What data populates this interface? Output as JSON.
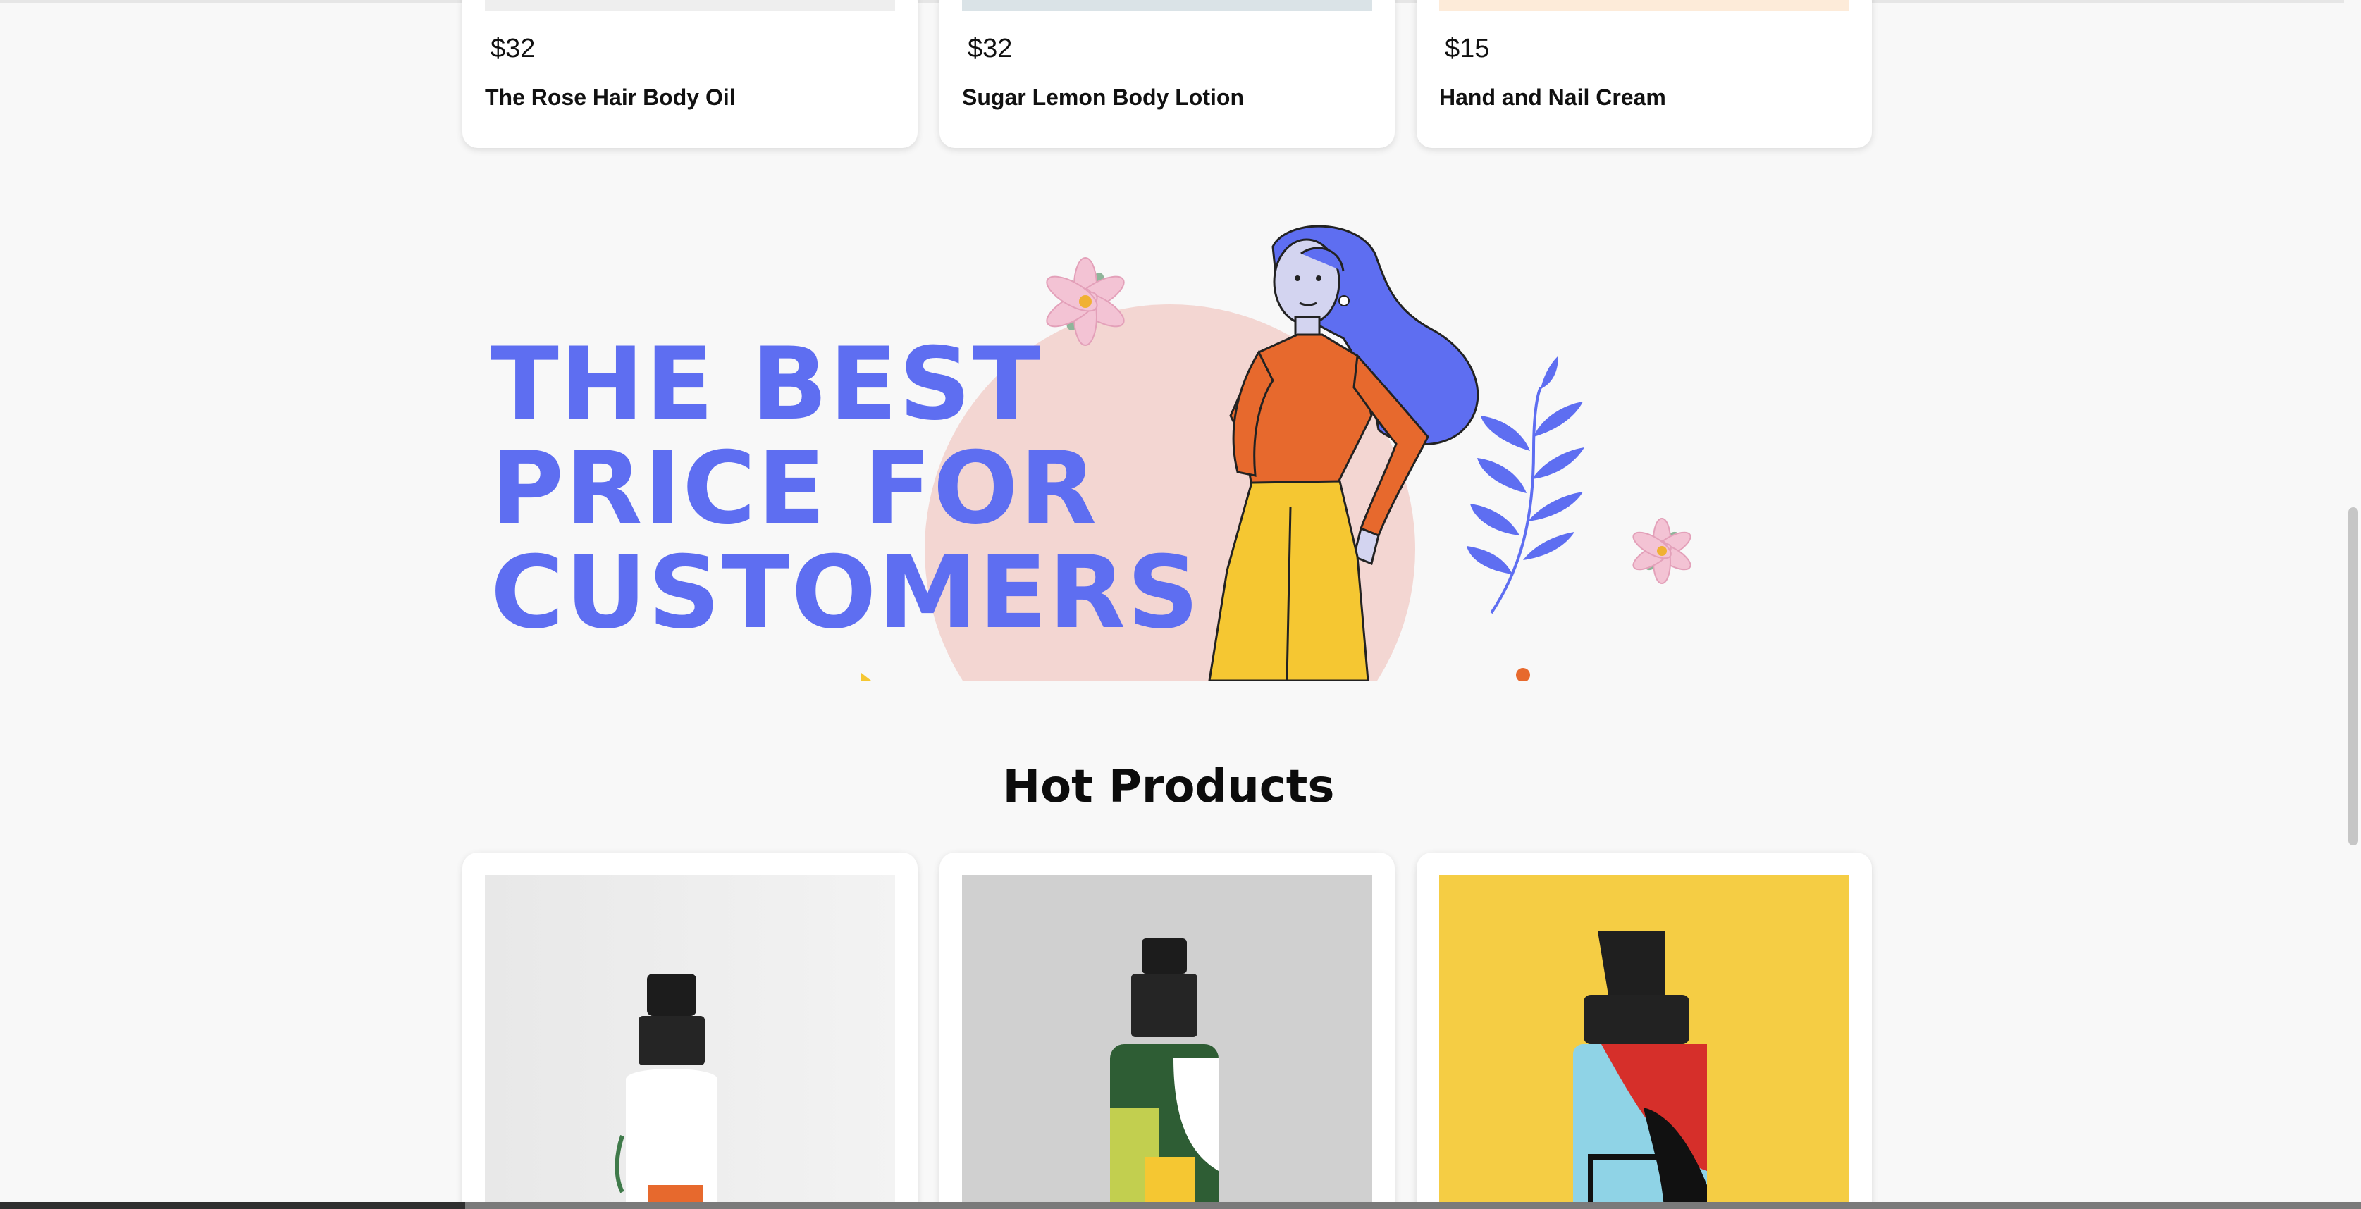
{
  "top_products": [
    {
      "price": "$32",
      "name": "The Rose Hair Body Oil",
      "strip_color": "#eeeeee"
    },
    {
      "price": "$32",
      "name": "Sugar Lemon Body Lotion",
      "strip_color": "#dae3e7"
    },
    {
      "price": "$15",
      "name": "Hand and Nail Cream",
      "strip_color": "#fdebd9"
    }
  ],
  "banner": {
    "headline_lines": [
      "THE BEST",
      "PRICE FOR",
      "CUSTOMERS"
    ]
  },
  "hot_products": {
    "title": "Hot Products",
    "items": [
      {
        "bg": "#f0f0f0"
      },
      {
        "bg": "#d0d0d0"
      },
      {
        "bg": "#f5cd44"
      }
    ]
  },
  "colors": {
    "accent": "#5e6ef1",
    "orange": "#e7692d",
    "yellow": "#f5c732",
    "pink": "#f3d6d2"
  }
}
